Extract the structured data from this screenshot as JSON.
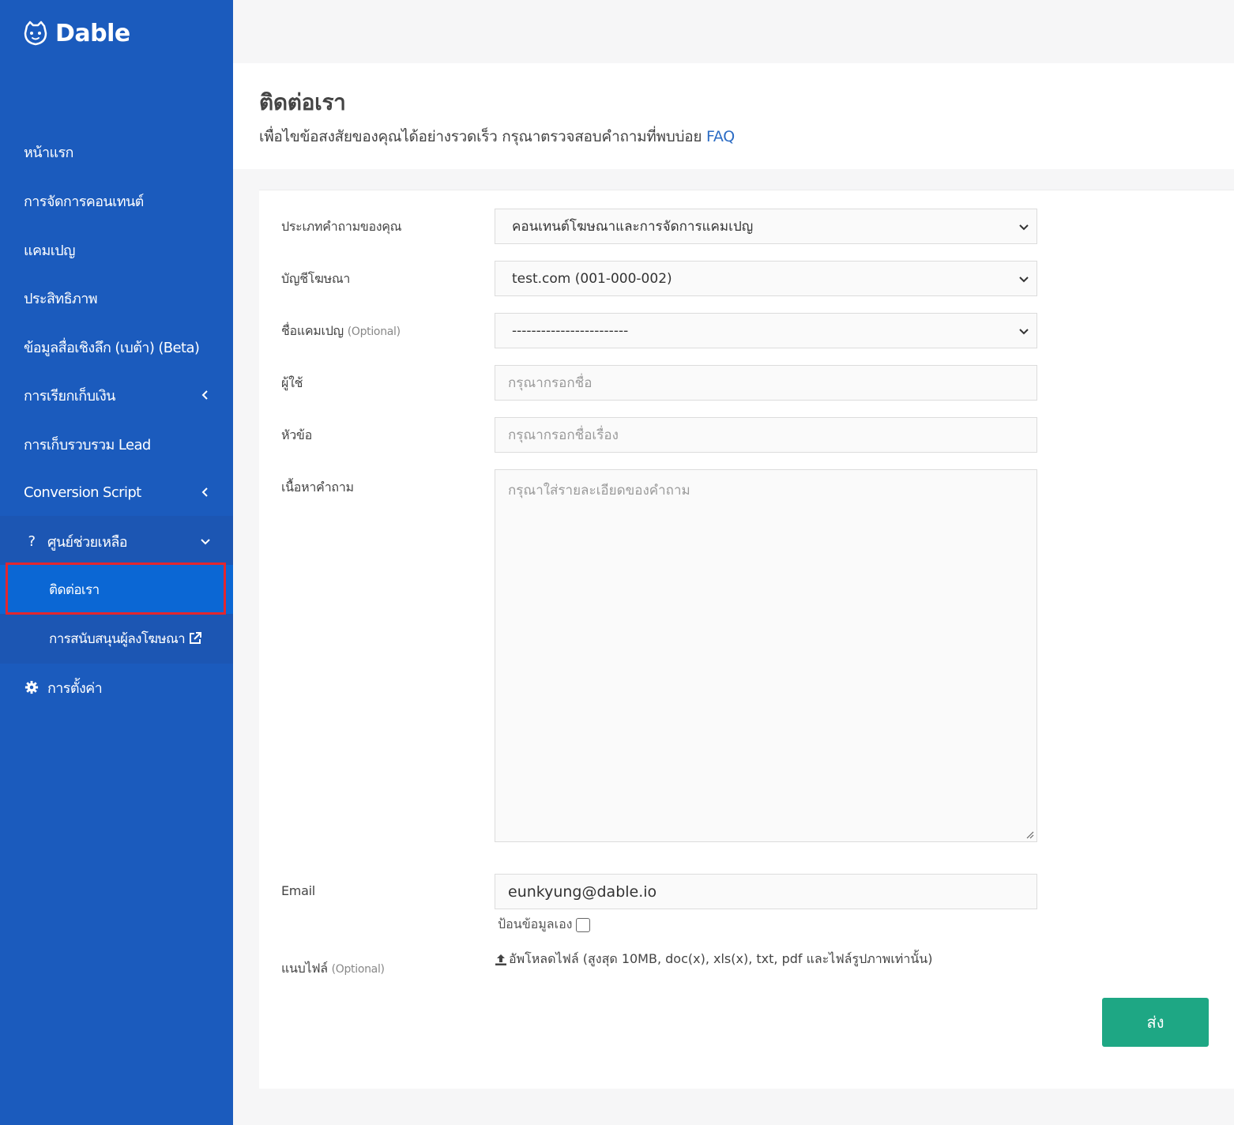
{
  "brand": {
    "name": "Dable"
  },
  "sidebar": {
    "items": [
      {
        "label": "หน้าแรก"
      },
      {
        "label": "การจัดการคอนเทนต์"
      },
      {
        "label": "แคมเปญ"
      },
      {
        "label": "ประสิทธิภาพ"
      },
      {
        "label": "ข้อมูลสื่อเชิงลึก (เบต้า) (Beta)"
      },
      {
        "label": "การเรียกเก็บเงิน"
      },
      {
        "label": "การเก็บรวบรวม Lead"
      },
      {
        "label": "Conversion Script"
      },
      {
        "label": "ศูนย์ช่วยเหลือ"
      },
      {
        "label": "การตั้งค่า"
      }
    ],
    "help_sub": [
      {
        "label": "ติดต่อเรา",
        "active": true
      },
      {
        "label": "การสนับสนุนผู้ลงโฆษณา"
      }
    ]
  },
  "header": {
    "title": "ติดต่อเรา",
    "subtitle": "เพื่อไขข้อสงสัยของคุณได้อย่างรวดเร็ว กรุณาตรวจสอบคำถามที่พบบ่อย",
    "faq_link": "FAQ"
  },
  "form": {
    "question_type": {
      "label": "ประเภทคำถามของคุณ",
      "value": "คอนเทนต์โฆษณาและการจัดการแคมเปญ"
    },
    "ad_account": {
      "label": "บัญชีโฆษณา",
      "value": "test.com (001-000-002)"
    },
    "campaign_name": {
      "label": "ชื่อแคมเปญ",
      "optional": "(Optional)",
      "value": "------------------------"
    },
    "user": {
      "label": "ผู้ใช้",
      "placeholder": "กรุณากรอกชื่อ"
    },
    "subject": {
      "label": "หัวข้อ",
      "placeholder": "กรุณากรอกชื่อเรื่อง"
    },
    "content": {
      "label": "เนื้อหาคำถาม",
      "placeholder": "กรุณาใส่รายละเอียดของคำถาม"
    },
    "email": {
      "label": "Email",
      "value": "eunkyung@dable.io",
      "self_input_label": "ป้อนข้อมูลเอง"
    },
    "attachment": {
      "label": "แนบไฟล์",
      "optional": "(Optional)",
      "upload_text": "อัพโหลดไฟล์ (สูงสุด 10MB, doc(x), xls(x), txt, pdf และไฟล์รูปภาพเท่านั้น)"
    },
    "submit_label": "ส่ง"
  },
  "colors": {
    "sidebar": "#1b5bbd",
    "active_item": "#0b67d4",
    "highlight_border": "#e3262e",
    "submit": "#1ea784",
    "link": "#2c6cc4"
  }
}
